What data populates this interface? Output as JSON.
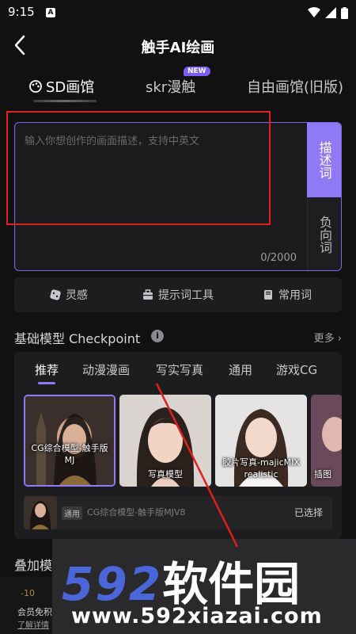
{
  "status": {
    "time": "9:15",
    "app_indicator": "A"
  },
  "nav": {
    "title": "触手AI绘画"
  },
  "tabs": [
    {
      "label": "SD画馆",
      "active": true
    },
    {
      "label": "skr漫触",
      "badge": "NEW"
    },
    {
      "label": "自由画馆(旧版)"
    }
  ],
  "prompt": {
    "placeholder": "输入你想创作的画面描述，支持中英文",
    "count": "0/2000",
    "desc_tab": "描述词",
    "neg_tab": "负向词"
  },
  "tools": [
    {
      "label": "灵感",
      "icon": "dice-icon"
    },
    {
      "label": "提示词工具",
      "icon": "toolbox-icon"
    },
    {
      "label": "常用词",
      "icon": "book-icon"
    }
  ],
  "section": {
    "title": "基础模型 Checkpoint",
    "more": "更多"
  },
  "model_tabs": [
    "推荐",
    "动漫漫画",
    "写实写真",
    "通用",
    "游戏CG"
  ],
  "cards": [
    {
      "label": "CG综合模型-触手版MJ"
    },
    {
      "label": "写真模型"
    },
    {
      "label": "胶片写真-majicMIX realistic"
    },
    {
      "label": "插图"
    }
  ],
  "selected": {
    "tag": "通用",
    "name": "CG综合模型-触手版MJV8",
    "status": "已选择"
  },
  "overlay_section": "叠加模",
  "bottom": {
    "line1": "-10",
    "line2": "会员免积",
    "line3": "了解详情"
  },
  "watermark": {
    "big": "592",
    "big_cn": "软件园",
    "small": "www.592xiazai.com"
  },
  "colors": {
    "accent": "#8f79f5",
    "annotation": "#e0201c"
  }
}
